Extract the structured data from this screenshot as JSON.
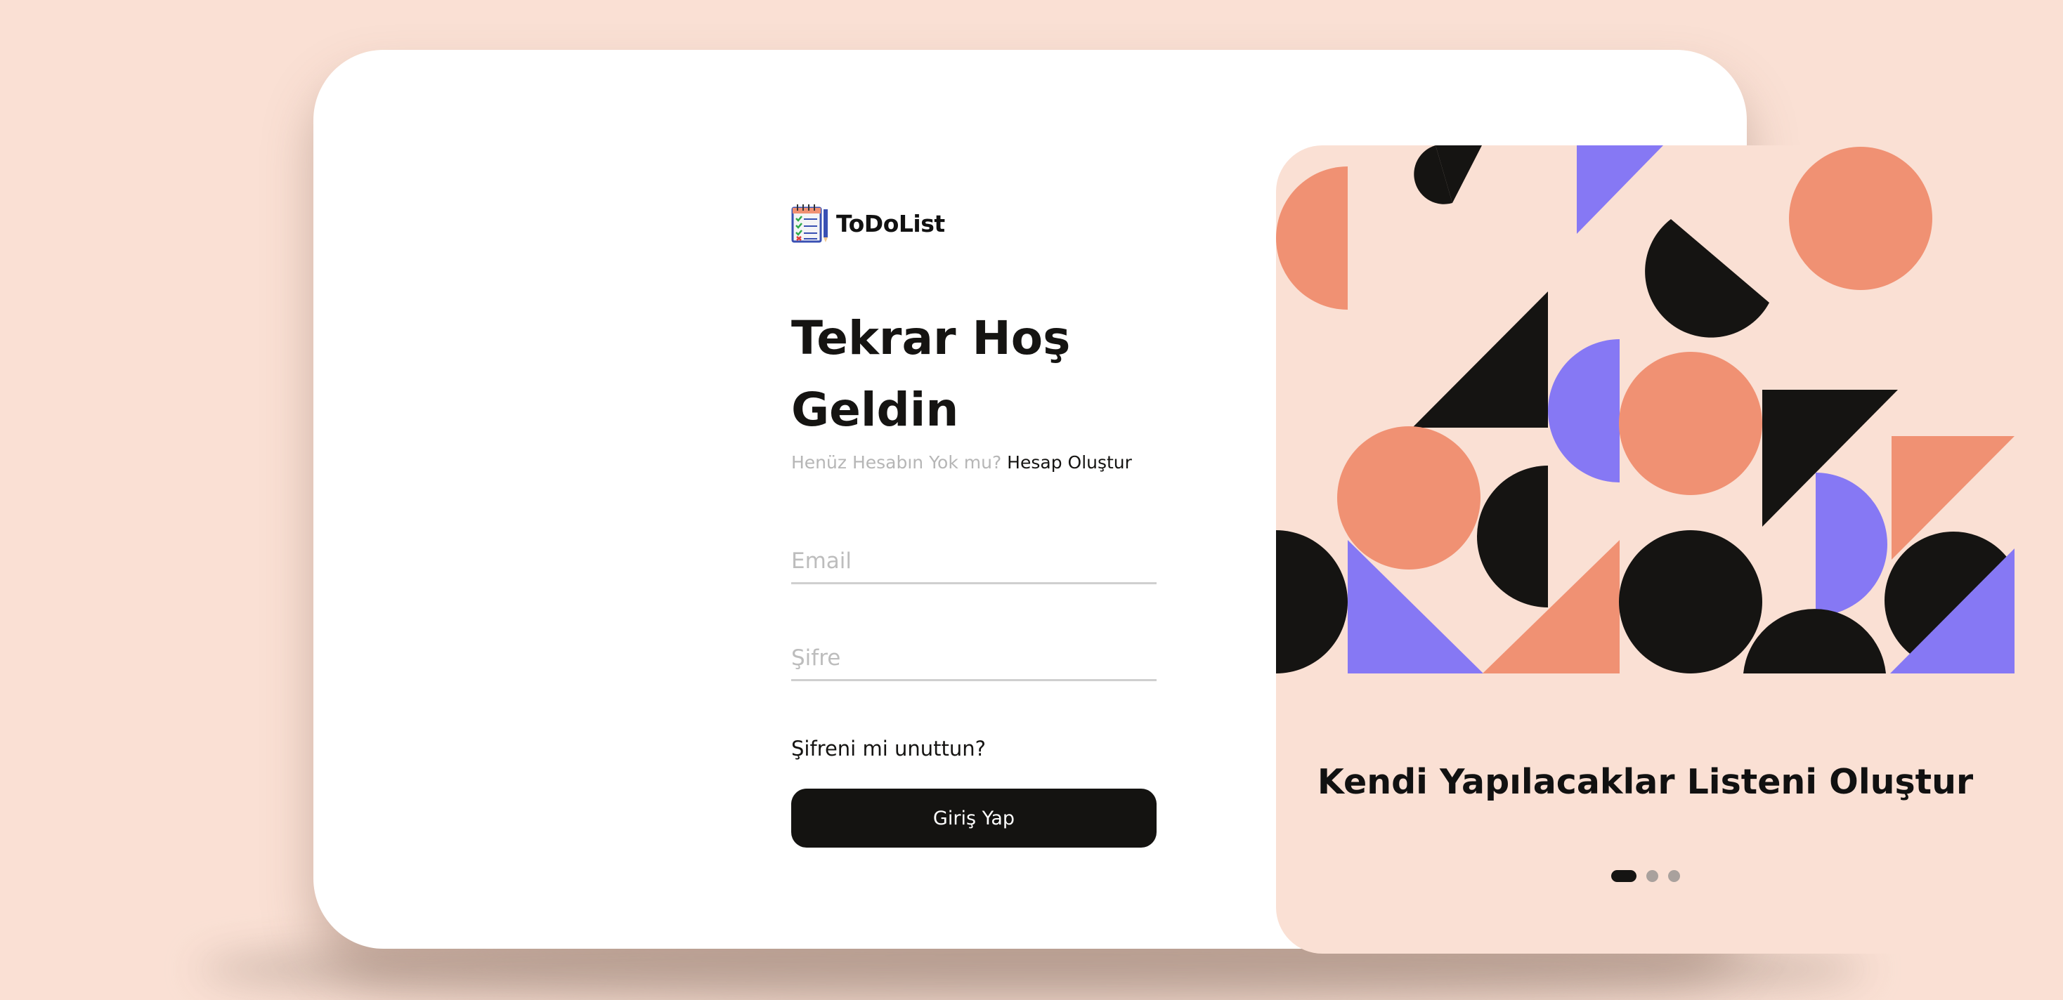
{
  "brand": {
    "name": "ToDoList",
    "icon": "notepad-checklist-icon"
  },
  "login": {
    "heading": "Tekrar Hoş Geldin",
    "no_account_text": "Henüz Hesabın Yok mu?",
    "create_account_link": "Hesap Oluştur",
    "email_placeholder": "Email",
    "email_value": "",
    "password_placeholder": "Şifre",
    "password_value": "",
    "forgot_password": "Şifreni mi unuttun?",
    "submit_label": "Giriş Yap"
  },
  "hero": {
    "title": "Kendi Yapılacaklar Listeni Oluştur",
    "slide_count": 3,
    "active_slide": 1
  },
  "colors": {
    "background": "#fae0d4",
    "card": "#ffffff",
    "primary_dark": "#141311",
    "accent_coral": "#f09173",
    "accent_purple": "#8678f4",
    "muted_text": "#b6b6b6"
  }
}
